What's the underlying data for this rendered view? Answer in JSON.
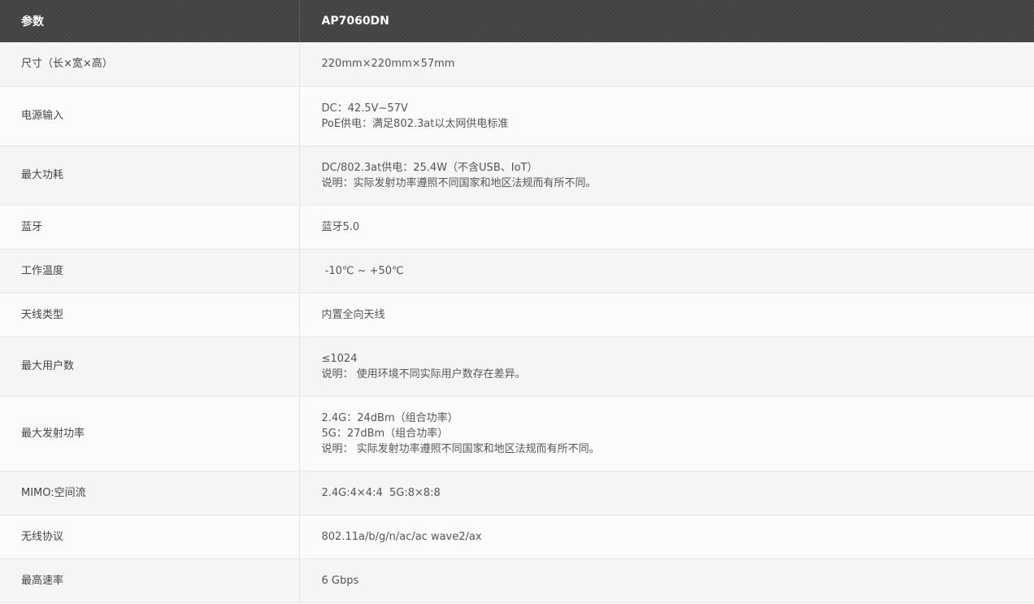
{
  "header": {
    "param_label": "参数",
    "model_label": "AP7060DN"
  },
  "rows": [
    {
      "label": "尺寸（长×宽×高）",
      "lines": [
        "220mm×220mm×57mm"
      ]
    },
    {
      "label": "电源输入",
      "lines": [
        "DC：42.5V~57V",
        "PoE供电：满足802.3at以太网供电标准"
      ]
    },
    {
      "label": "最大功耗",
      "lines": [
        "DC/802.3at供电：25.4W（不含USB、IoT）",
        "说明：实际发射功率遵照不同国家和地区法规而有所不同。"
      ]
    },
    {
      "label": "蓝牙",
      "lines": [
        "蓝牙5.0"
      ]
    },
    {
      "label": "工作温度",
      "lines": [
        " -10℃ ~ +50℃"
      ]
    },
    {
      "label": "天线类型",
      "lines": [
        "内置全向天线"
      ]
    },
    {
      "label": "最大用户数",
      "lines": [
        "≤1024",
        "说明： 使用环境不同实际用户数存在差异。"
      ]
    },
    {
      "label": "最大发射功率",
      "lines": [
        "2.4G：24dBm（组合功率）",
        "5G：27dBm（组合功率）",
        "说明： 实际发射功率遵照不同国家和地区法规而有所不同。"
      ]
    },
    {
      "label": "MIMO:空间流",
      "lines": [
        "2.4G:4×4:4  5G:8×8:8"
      ]
    },
    {
      "label": "无线协议",
      "lines": [
        "802.11a/b/g/n/ac/ac wave2/ax"
      ]
    },
    {
      "label": "最高速率",
      "lines": [
        "6 Gbps"
      ]
    }
  ]
}
